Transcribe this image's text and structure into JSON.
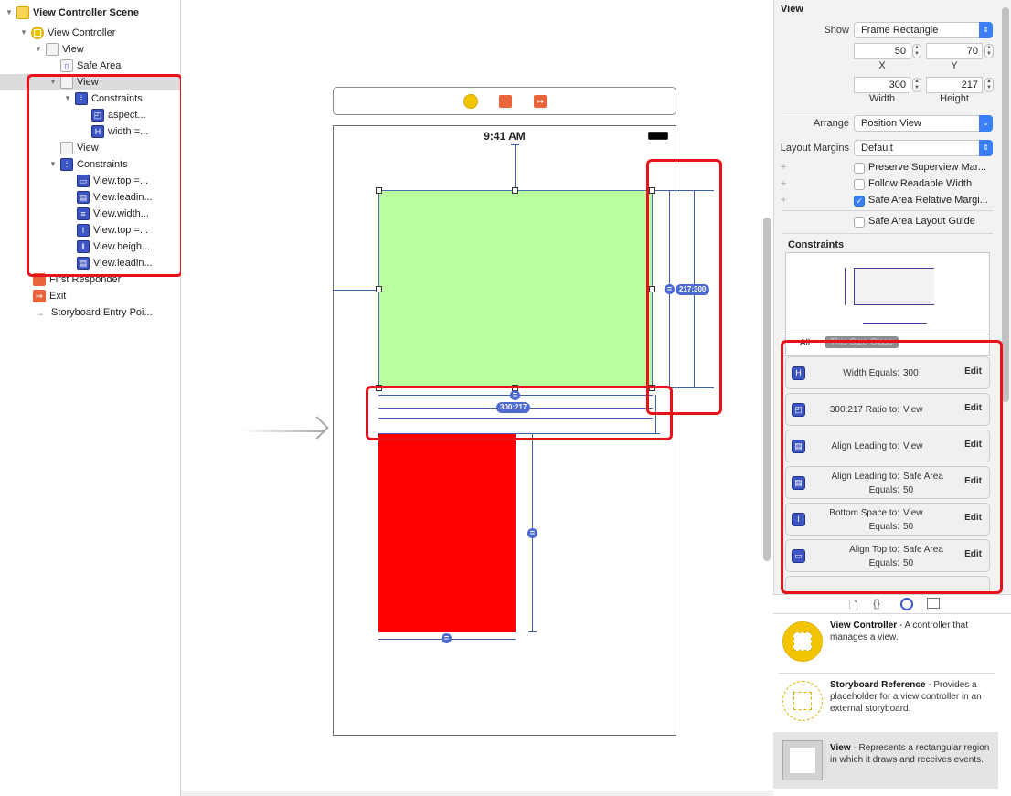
{
  "outline": {
    "items": [
      {
        "label": "View Controller Scene",
        "icon": "scene-icon",
        "bold": true
      },
      {
        "label": "View Controller",
        "icon": "view-controller-icon"
      },
      {
        "label": "View",
        "icon": "view-icon"
      },
      {
        "label": "Safe Area",
        "icon": "safe-area-icon"
      },
      {
        "label": "View",
        "icon": "view-icon",
        "selected": true
      },
      {
        "label": "Constraints",
        "icon": "constraints-icon"
      },
      {
        "label": "aspect...",
        "icon": "aspect-constraint-icon"
      },
      {
        "label": "width =...",
        "icon": "width-constraint-icon"
      },
      {
        "label": "View",
        "icon": "view-icon"
      },
      {
        "label": "Constraints",
        "icon": "constraints-icon"
      },
      {
        "label": "View.top =...",
        "icon": "top-constraint-icon"
      },
      {
        "label": "View.leadin...",
        "icon": "leading-constraint-icon"
      },
      {
        "label": "View.width...",
        "icon": "width-constraint-icon"
      },
      {
        "label": "View.top =...",
        "icon": "vertical-spacing-icon"
      },
      {
        "label": "View.heigh...",
        "icon": "height-constraint-icon"
      },
      {
        "label": "View.leadin...",
        "icon": "leading-constraint-icon"
      },
      {
        "label": "First Responder",
        "icon": "first-responder-icon"
      },
      {
        "label": "Exit",
        "icon": "exit-icon"
      },
      {
        "label": "Storyboard Entry Poi...",
        "icon": "entry-arrow-icon"
      }
    ]
  },
  "canvas": {
    "status_time": "9:41 AM",
    "scene_dock_icons": [
      "view-controller-icon",
      "first-responder-icon",
      "exit-icon"
    ],
    "ratio_label_h": "300:217",
    "ratio_label_v": "217:300",
    "green_view_color": "#baff9f",
    "red_view_color": "#ff0000"
  },
  "inspector": {
    "section_title": "View",
    "show_label": "Show",
    "show_value": "Frame Rectangle",
    "x_value": "50",
    "y_value": "70",
    "x_label": "X",
    "y_label": "Y",
    "width_value": "300",
    "height_value": "217",
    "width_label": "Width",
    "height_label": "Height",
    "arrange_label": "Arrange",
    "arrange_value": "Position View",
    "margins_label": "Layout Margins",
    "margins_value": "Default",
    "checkboxes": [
      {
        "label": "Preserve Superview Mar...",
        "checked": false
      },
      {
        "label": "Follow Readable Width",
        "checked": false
      },
      {
        "label": "Safe Area Relative Margi...",
        "checked": true
      },
      {
        "label": "Safe Area Layout Guide",
        "checked": false
      }
    ],
    "constraints_title": "Constraints",
    "filter_all": "All",
    "filter_size_class": "This Size Class",
    "constraints": [
      {
        "line1": "Width Equals:",
        "val1": "300",
        "line2": "",
        "val2": "",
        "edit": "Edit"
      },
      {
        "line1": "300:217 Ratio to:",
        "val1": "View",
        "line2": "",
        "val2": "",
        "edit": "Edit"
      },
      {
        "line1": "Align Leading to:",
        "val1": "View",
        "line2": "",
        "val2": "",
        "edit": "Edit"
      },
      {
        "line1": "Align Leading to:",
        "val1": "Safe Area",
        "line2": "Equals:",
        "val2": "50",
        "edit": "Edit"
      },
      {
        "line1": "Bottom Space to:",
        "val1": "View",
        "line2": "Equals:",
        "val2": "50",
        "edit": "Edit"
      },
      {
        "line1": "Align Top to:",
        "val1": "Safe Area",
        "line2": "Equals:",
        "val2": "50",
        "edit": "Edit"
      }
    ]
  },
  "library": {
    "tabs": [
      "file-template-icon",
      "code-snippet-icon",
      "object-library-icon",
      "media-library-icon"
    ],
    "items": [
      {
        "title": "View Controller",
        "desc": " - A controller that manages a view."
      },
      {
        "title": "Storyboard Reference",
        "desc": " - Provides a placeholder for a view controller in an external storyboard."
      },
      {
        "title": "View",
        "desc": " - Represents a rectangular region in which it draws and receives events."
      }
    ]
  }
}
